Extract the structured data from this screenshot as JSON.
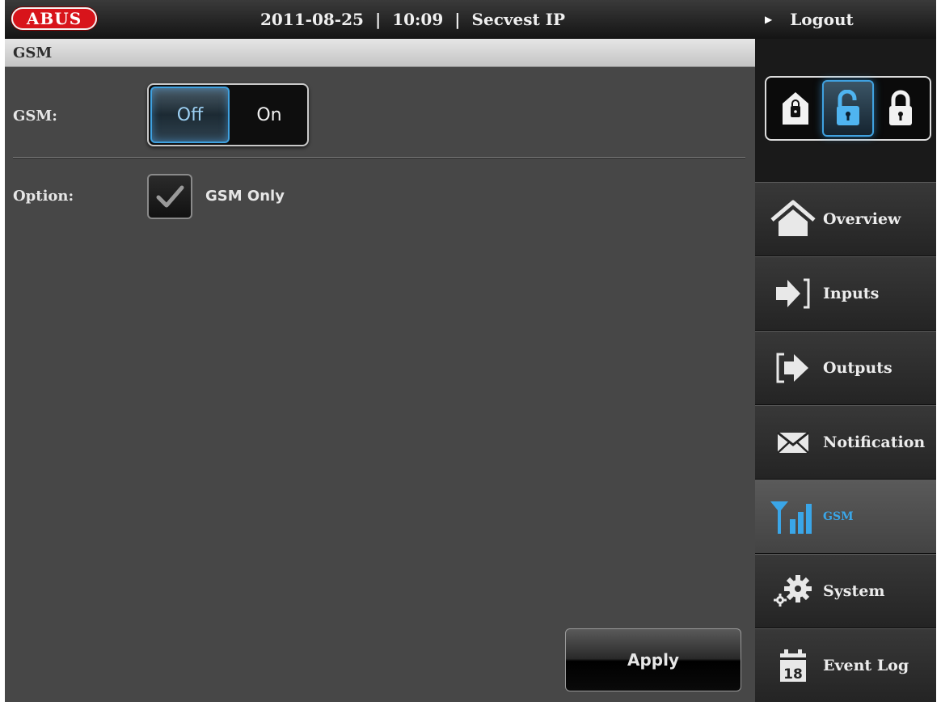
{
  "header": {
    "brand": "ABUS",
    "date": "2011-08-25",
    "time": "10:09",
    "device": "Secvest IP",
    "separator": "|",
    "logout_label": "Logout"
  },
  "section": {
    "title": "GSM"
  },
  "gsm_setting": {
    "label": "GSM:",
    "off_label": "Off",
    "on_label": "On",
    "selected": "Off"
  },
  "option_setting": {
    "label": "Option:",
    "checkbox_label": "GSM Only",
    "checked": true
  },
  "apply_label": "Apply",
  "lock_modes": {
    "items": [
      "lock-home-icon",
      "lock-open-icon",
      "lock-closed-icon"
    ],
    "active_index": 1
  },
  "nav": {
    "items": [
      {
        "label": "Overview",
        "icon": "home-icon"
      },
      {
        "label": "Inputs",
        "icon": "input-arrow-icon"
      },
      {
        "label": "Outputs",
        "icon": "output-arrow-icon"
      },
      {
        "label": "Notification",
        "icon": "envelope-icon"
      },
      {
        "label": "GSM",
        "icon": "signal-icon"
      },
      {
        "label": "System",
        "icon": "gears-icon"
      },
      {
        "label": "Event Log",
        "icon": "calendar-icon"
      }
    ],
    "active_index": 4
  },
  "colors": {
    "accent": "#3aa6e8",
    "brand_red": "#d8141b"
  }
}
